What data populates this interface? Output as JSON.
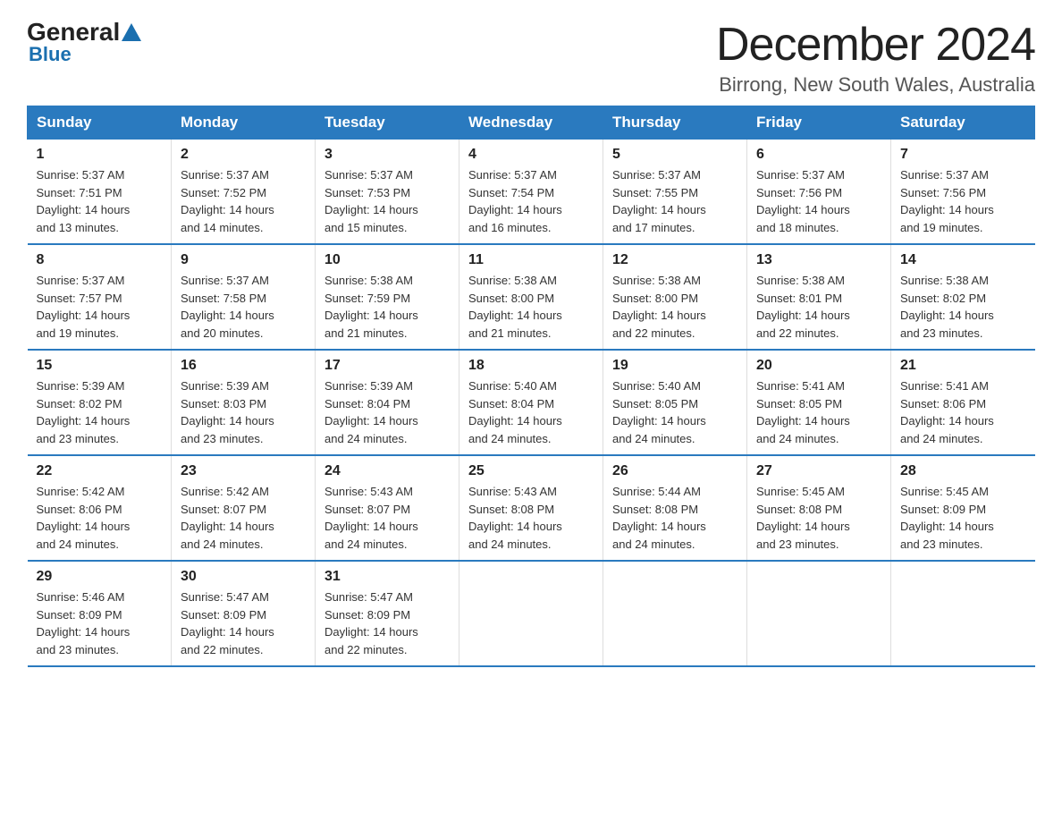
{
  "logo": {
    "general": "General",
    "triangle": "▲",
    "blue": "Blue"
  },
  "title": "December 2024",
  "subtitle": "Birrong, New South Wales, Australia",
  "days_of_week": [
    "Sunday",
    "Monday",
    "Tuesday",
    "Wednesday",
    "Thursday",
    "Friday",
    "Saturday"
  ],
  "weeks": [
    [
      {
        "day": "1",
        "sunrise": "5:37 AM",
        "sunset": "7:51 PM",
        "daylight": "14 hours and 13 minutes."
      },
      {
        "day": "2",
        "sunrise": "5:37 AM",
        "sunset": "7:52 PM",
        "daylight": "14 hours and 14 minutes."
      },
      {
        "day": "3",
        "sunrise": "5:37 AM",
        "sunset": "7:53 PM",
        "daylight": "14 hours and 15 minutes."
      },
      {
        "day": "4",
        "sunrise": "5:37 AM",
        "sunset": "7:54 PM",
        "daylight": "14 hours and 16 minutes."
      },
      {
        "day": "5",
        "sunrise": "5:37 AM",
        "sunset": "7:55 PM",
        "daylight": "14 hours and 17 minutes."
      },
      {
        "day": "6",
        "sunrise": "5:37 AM",
        "sunset": "7:56 PM",
        "daylight": "14 hours and 18 minutes."
      },
      {
        "day": "7",
        "sunrise": "5:37 AM",
        "sunset": "7:56 PM",
        "daylight": "14 hours and 19 minutes."
      }
    ],
    [
      {
        "day": "8",
        "sunrise": "5:37 AM",
        "sunset": "7:57 PM",
        "daylight": "14 hours and 19 minutes."
      },
      {
        "day": "9",
        "sunrise": "5:37 AM",
        "sunset": "7:58 PM",
        "daylight": "14 hours and 20 minutes."
      },
      {
        "day": "10",
        "sunrise": "5:38 AM",
        "sunset": "7:59 PM",
        "daylight": "14 hours and 21 minutes."
      },
      {
        "day": "11",
        "sunrise": "5:38 AM",
        "sunset": "8:00 PM",
        "daylight": "14 hours and 21 minutes."
      },
      {
        "day": "12",
        "sunrise": "5:38 AM",
        "sunset": "8:00 PM",
        "daylight": "14 hours and 22 minutes."
      },
      {
        "day": "13",
        "sunrise": "5:38 AM",
        "sunset": "8:01 PM",
        "daylight": "14 hours and 22 minutes."
      },
      {
        "day": "14",
        "sunrise": "5:38 AM",
        "sunset": "8:02 PM",
        "daylight": "14 hours and 23 minutes."
      }
    ],
    [
      {
        "day": "15",
        "sunrise": "5:39 AM",
        "sunset": "8:02 PM",
        "daylight": "14 hours and 23 minutes."
      },
      {
        "day": "16",
        "sunrise": "5:39 AM",
        "sunset": "8:03 PM",
        "daylight": "14 hours and 23 minutes."
      },
      {
        "day": "17",
        "sunrise": "5:39 AM",
        "sunset": "8:04 PM",
        "daylight": "14 hours and 24 minutes."
      },
      {
        "day": "18",
        "sunrise": "5:40 AM",
        "sunset": "8:04 PM",
        "daylight": "14 hours and 24 minutes."
      },
      {
        "day": "19",
        "sunrise": "5:40 AM",
        "sunset": "8:05 PM",
        "daylight": "14 hours and 24 minutes."
      },
      {
        "day": "20",
        "sunrise": "5:41 AM",
        "sunset": "8:05 PM",
        "daylight": "14 hours and 24 minutes."
      },
      {
        "day": "21",
        "sunrise": "5:41 AM",
        "sunset": "8:06 PM",
        "daylight": "14 hours and 24 minutes."
      }
    ],
    [
      {
        "day": "22",
        "sunrise": "5:42 AM",
        "sunset": "8:06 PM",
        "daylight": "14 hours and 24 minutes."
      },
      {
        "day": "23",
        "sunrise": "5:42 AM",
        "sunset": "8:07 PM",
        "daylight": "14 hours and 24 minutes."
      },
      {
        "day": "24",
        "sunrise": "5:43 AM",
        "sunset": "8:07 PM",
        "daylight": "14 hours and 24 minutes."
      },
      {
        "day": "25",
        "sunrise": "5:43 AM",
        "sunset": "8:08 PM",
        "daylight": "14 hours and 24 minutes."
      },
      {
        "day": "26",
        "sunrise": "5:44 AM",
        "sunset": "8:08 PM",
        "daylight": "14 hours and 24 minutes."
      },
      {
        "day": "27",
        "sunrise": "5:45 AM",
        "sunset": "8:08 PM",
        "daylight": "14 hours and 23 minutes."
      },
      {
        "day": "28",
        "sunrise": "5:45 AM",
        "sunset": "8:09 PM",
        "daylight": "14 hours and 23 minutes."
      }
    ],
    [
      {
        "day": "29",
        "sunrise": "5:46 AM",
        "sunset": "8:09 PM",
        "daylight": "14 hours and 23 minutes."
      },
      {
        "day": "30",
        "sunrise": "5:47 AM",
        "sunset": "8:09 PM",
        "daylight": "14 hours and 22 minutes."
      },
      {
        "day": "31",
        "sunrise": "5:47 AM",
        "sunset": "8:09 PM",
        "daylight": "14 hours and 22 minutes."
      },
      null,
      null,
      null,
      null
    ]
  ],
  "labels": {
    "sunrise": "Sunrise:",
    "sunset": "Sunset:",
    "daylight": "Daylight:"
  }
}
